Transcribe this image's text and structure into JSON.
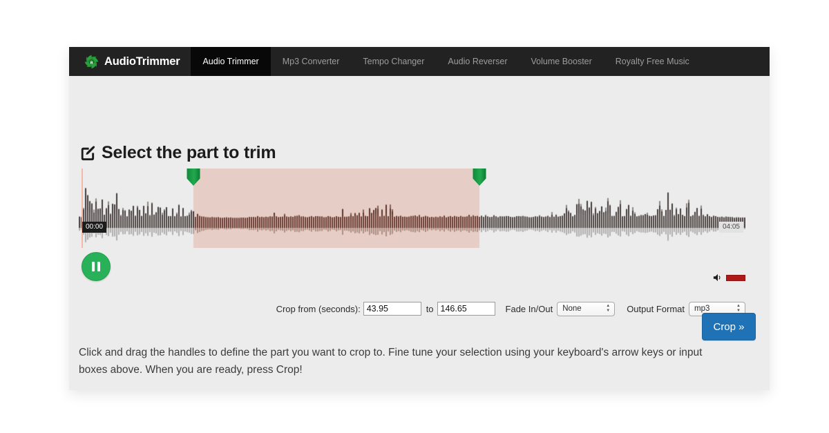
{
  "brand": {
    "name": "AudioTrimmer",
    "logo_icon": "pinwheel-logo-icon"
  },
  "nav": {
    "items": [
      {
        "label": "Audio Trimmer",
        "active": true
      },
      {
        "label": "Mp3 Converter",
        "active": false
      },
      {
        "label": "Tempo Changer",
        "active": false
      },
      {
        "label": "Audio Reverser",
        "active": false
      },
      {
        "label": "Volume Booster",
        "active": false
      },
      {
        "label": "Royalty Free Music",
        "active": false
      }
    ]
  },
  "heading": {
    "icon": "edit-square-icon",
    "title": "Select the part to trim"
  },
  "waveform": {
    "start_time_label": "00:00",
    "end_time_label": "04:05",
    "selection_start_pct": 17.2,
    "selection_end_pct": 60.1,
    "left_handle_icon": "selection-handle-marker",
    "right_handle_icon": "selection-handle-marker",
    "wave_color": "#4a403f",
    "wave_bg": "#ececec",
    "selection_tint": "#e95028",
    "handle_color": "#1a9b46",
    "playhead_color": "#f3b9a6"
  },
  "transport": {
    "playpause_state": "pause",
    "playpause_icon": "pause-icon",
    "playpause_color": "#28b158",
    "speaker_icon": "speaker-icon",
    "volume_slider_color": "#b11818"
  },
  "controls": {
    "crop_from_label": "Crop from (seconds):",
    "crop_from_value": "43.95",
    "to_label": "to",
    "crop_to_value": "146.65",
    "fade_label": "Fade In/Out",
    "fade_value": "None",
    "fade_options": [
      "None"
    ],
    "format_label": "Output Format",
    "format_value": "mp3",
    "format_options": [
      "mp3"
    ]
  },
  "actions": {
    "crop_button_label": "Crop »",
    "crop_button_color": "#1f72b5"
  },
  "helper": {
    "text": "Click and drag the handles to define the part you want to crop to. Fine tune your selection using your keyboard's arrow keys or input boxes above. When you are ready, press Crop!"
  }
}
